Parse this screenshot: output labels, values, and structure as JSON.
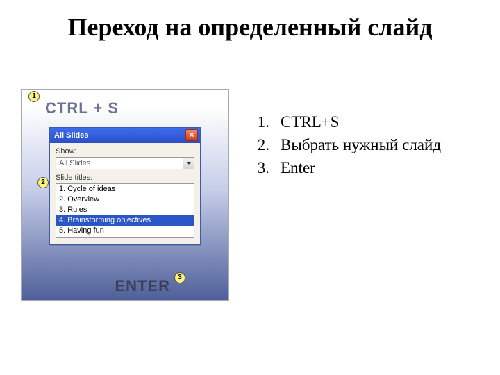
{
  "title": "Переход на определенный слайд",
  "illustration": {
    "ctrl_label": "CTRL + S",
    "enter_label": "ENTER",
    "markers": {
      "m1": "1",
      "m2": "2",
      "m3": "3"
    },
    "dialog": {
      "title": "All Slides",
      "close_glyph": "×",
      "show_label": "Show:",
      "show_value": "All Slides",
      "titles_label": "Slide titles:",
      "items": [
        "1. Cycle of ideas",
        "2. Overview",
        "3. Rules",
        "4. Brainstorming objectives",
        "5. Having fun"
      ],
      "selected_index": 3
    }
  },
  "steps": [
    {
      "n": "1.",
      "t": "CTRL+S"
    },
    {
      "n": "2.",
      "t": "Выбрать нужный слайд"
    },
    {
      "n": "3.",
      "t": "Enter"
    }
  ]
}
